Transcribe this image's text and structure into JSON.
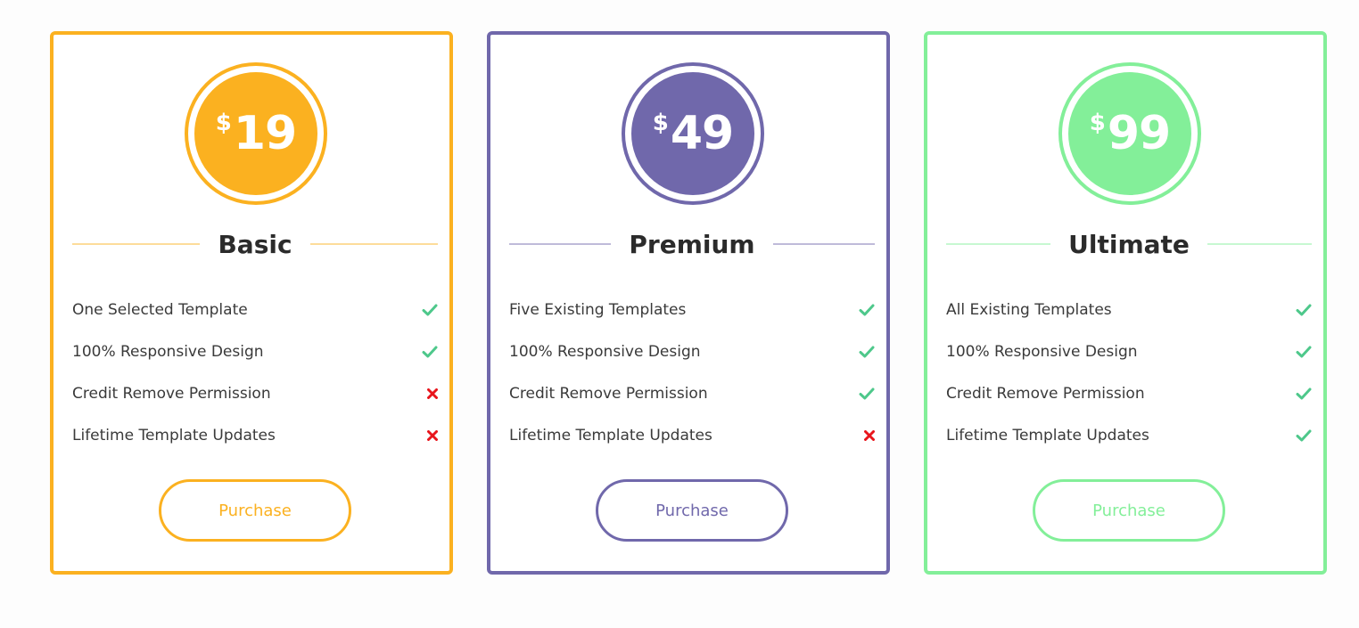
{
  "plans": [
    {
      "name": "Basic",
      "currency": "$",
      "price": "19",
      "color": "#fbb120",
      "purchase_label": "Purchase",
      "features": [
        {
          "label": "One Selected Template",
          "status": "check"
        },
        {
          "label": "100% Responsive Design",
          "status": "check"
        },
        {
          "label": "Credit Remove Permission",
          "status": "cross"
        },
        {
          "label": "Lifetime Template Updates",
          "status": "cross"
        }
      ]
    },
    {
      "name": "Premium",
      "currency": "$",
      "price": "49",
      "color": "#7068ab",
      "purchase_label": "Purchase",
      "features": [
        {
          "label": "Five Existing Templates",
          "status": "check"
        },
        {
          "label": "100% Responsive Design",
          "status": "check"
        },
        {
          "label": "Credit Remove Permission",
          "status": "check"
        },
        {
          "label": "Lifetime Template Updates",
          "status": "cross"
        }
      ]
    },
    {
      "name": "Ultimate",
      "currency": "$",
      "price": "99",
      "color": "#83ef99",
      "purchase_label": "Purchase",
      "features": [
        {
          "label": "All Existing Templates",
          "status": "check"
        },
        {
          "label": "100% Responsive Design",
          "status": "check"
        },
        {
          "label": "Credit Remove Permission",
          "status": "check"
        },
        {
          "label": "Lifetime Template Updates",
          "status": "check"
        }
      ]
    }
  ],
  "colors": {
    "check": "#4ec88b",
    "cross": "#e8151c"
  },
  "icons": {
    "check": "check-icon",
    "cross": "cross-icon"
  }
}
